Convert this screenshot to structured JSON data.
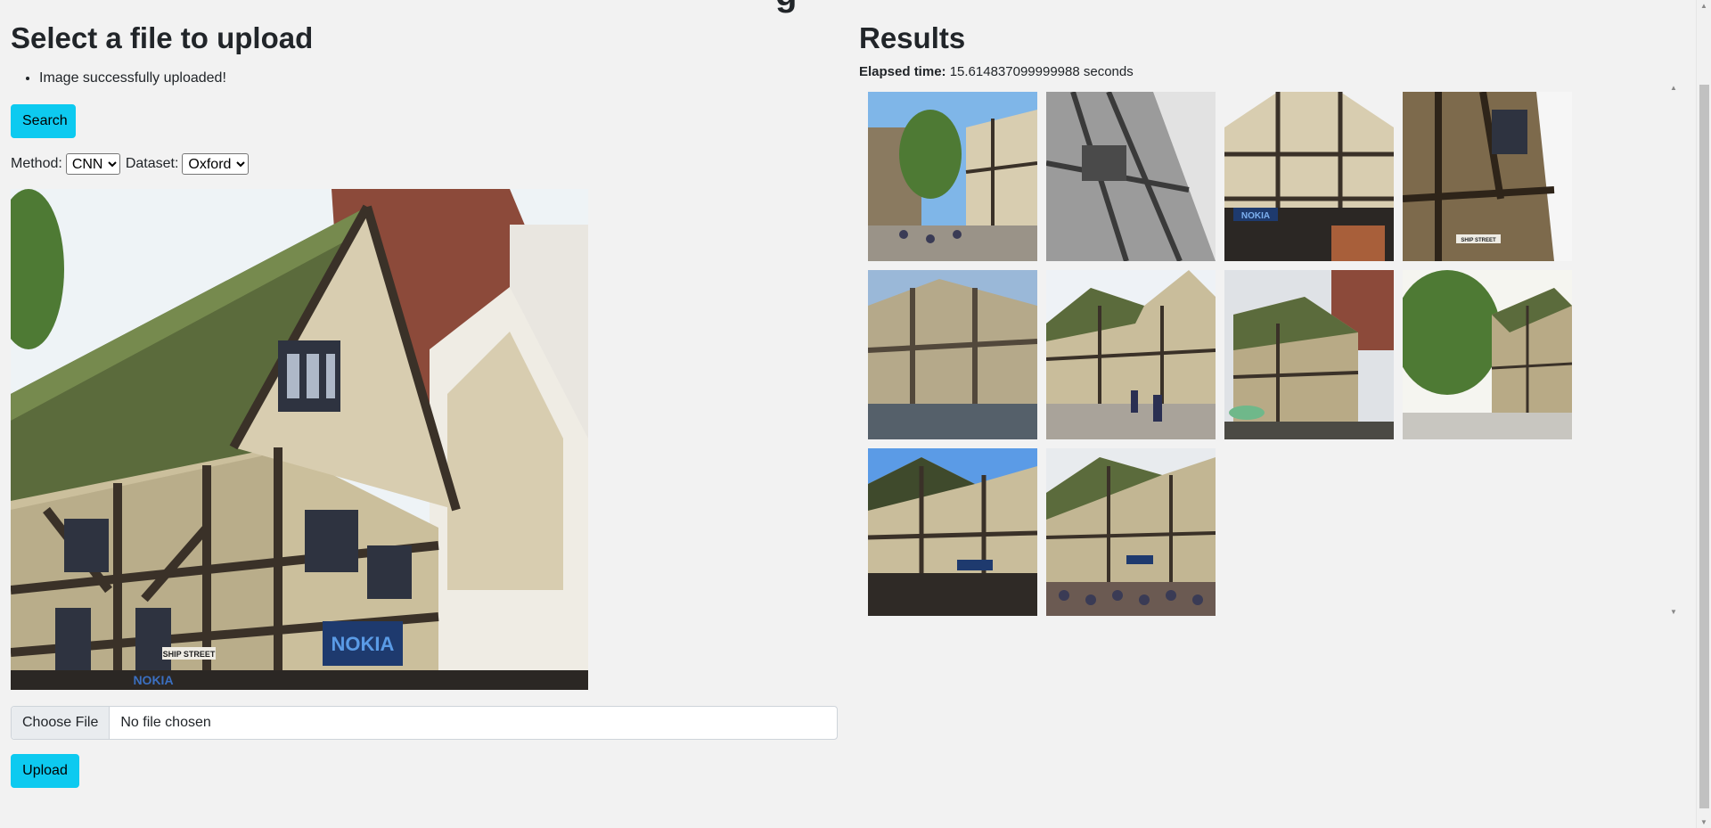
{
  "top_partial": "g",
  "upload": {
    "title": "Select a file to upload",
    "messages": [
      "Image successfully uploaded!"
    ],
    "search_label": "Search",
    "method_label": "Method:",
    "method_options": [
      "CNN"
    ],
    "method_selected": "CNN",
    "dataset_label": "Dataset:",
    "dataset_options": [
      "Oxford"
    ],
    "dataset_selected": "Oxford",
    "choose_file_label": "Choose File",
    "file_status": "No file chosen",
    "upload_label": "Upload",
    "preview_signs": [
      "SHIP STREET",
      "NOKIA",
      "NOKIA"
    ]
  },
  "results": {
    "title": "Results",
    "elapsed_label": "Elapsed time:",
    "elapsed_value": "15.614837099999988 seconds",
    "thumbnails": [
      {
        "sign": ""
      },
      {
        "sign": ""
      },
      {
        "sign": "NOKIA"
      },
      {
        "sign": "SHIP STREET"
      },
      {
        "sign": ""
      },
      {
        "sign": ""
      },
      {
        "sign": ""
      },
      {
        "sign": ""
      },
      {
        "sign": ""
      },
      {
        "sign": ""
      }
    ]
  },
  "colors": {
    "background": "#f2f2f2",
    "button": "#0dcaf0",
    "timber": "#3a3128",
    "plaster": "#d8cdb0",
    "roof": "#5b6b3c",
    "brick": "#8c4a3a",
    "sky": "#7fb6e8"
  }
}
